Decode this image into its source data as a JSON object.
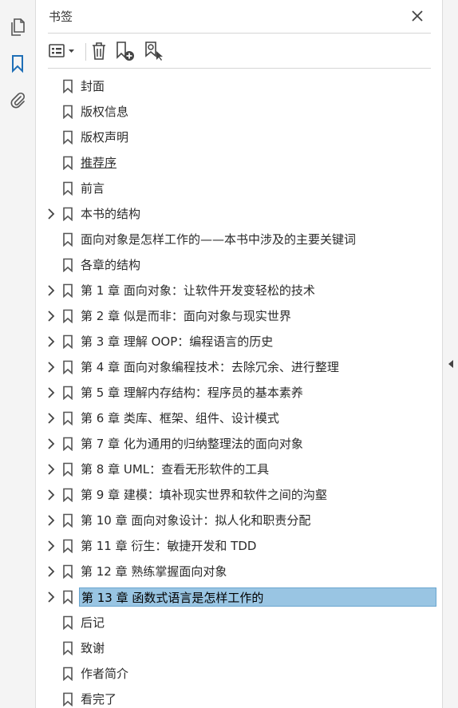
{
  "panel": {
    "title": "书签"
  },
  "colors": {
    "selection": "#99c5e3",
    "icon": "#555555",
    "accent": "#1f6fb7"
  },
  "icons": {
    "rail": [
      "pages-icon",
      "bookmark-icon",
      "attachment-icon"
    ],
    "toolbar": [
      "options-list-icon",
      "delete-trash-icon",
      "add-bookmark-icon",
      "find-bookmark-icon"
    ]
  },
  "bookmarks": [
    {
      "label": "封面",
      "expandable": false
    },
    {
      "label": "版权信息",
      "expandable": false
    },
    {
      "label": "版权声明",
      "expandable": false
    },
    {
      "label": "推荐序",
      "expandable": false
    },
    {
      "label": "前言",
      "expandable": false
    },
    {
      "label": "本书的结构",
      "expandable": true
    },
    {
      "label": "面向对象是怎样工作的——本书中涉及的主要关键词",
      "expandable": false
    },
    {
      "label": "各章的结构",
      "expandable": false
    },
    {
      "label": "第 1 章 面向对象：让软件开发变轻松的技术",
      "expandable": true
    },
    {
      "label": "第 2 章 似是而非：面向对象与现实世界",
      "expandable": true
    },
    {
      "label": "第 3 章 理解 OOP：编程语言的历史",
      "expandable": true
    },
    {
      "label": "第 4 章 面向对象编程技术：去除冗余、进行整理",
      "expandable": true
    },
    {
      "label": "第 5 章 理解内存结构：程序员的基本素养",
      "expandable": true
    },
    {
      "label": "第 6 章 类库、框架、组件、设计模式",
      "expandable": true
    },
    {
      "label": "第 7 章 化为通用的归纳整理法的面向对象",
      "expandable": true
    },
    {
      "label": "第 8 章 UML：查看无形软件的工具",
      "expandable": true
    },
    {
      "label": "第 9 章 建模：填补现实世界和软件之间的沟壑",
      "expandable": true
    },
    {
      "label": "第 10 章 面向对象设计：拟人化和职责分配",
      "expandable": true
    },
    {
      "label": "第 11 章 衍生：敏捷开发和 TDD",
      "expandable": true
    },
    {
      "label": "第 12 章 熟练掌握面向对象",
      "expandable": true
    },
    {
      "label": "第 13 章 函数式语言是怎样工作的",
      "expandable": true
    },
    {
      "label": "后记",
      "expandable": false
    },
    {
      "label": "致谢",
      "expandable": false
    },
    {
      "label": "作者简介",
      "expandable": false
    },
    {
      "label": "看完了",
      "expandable": false
    }
  ]
}
